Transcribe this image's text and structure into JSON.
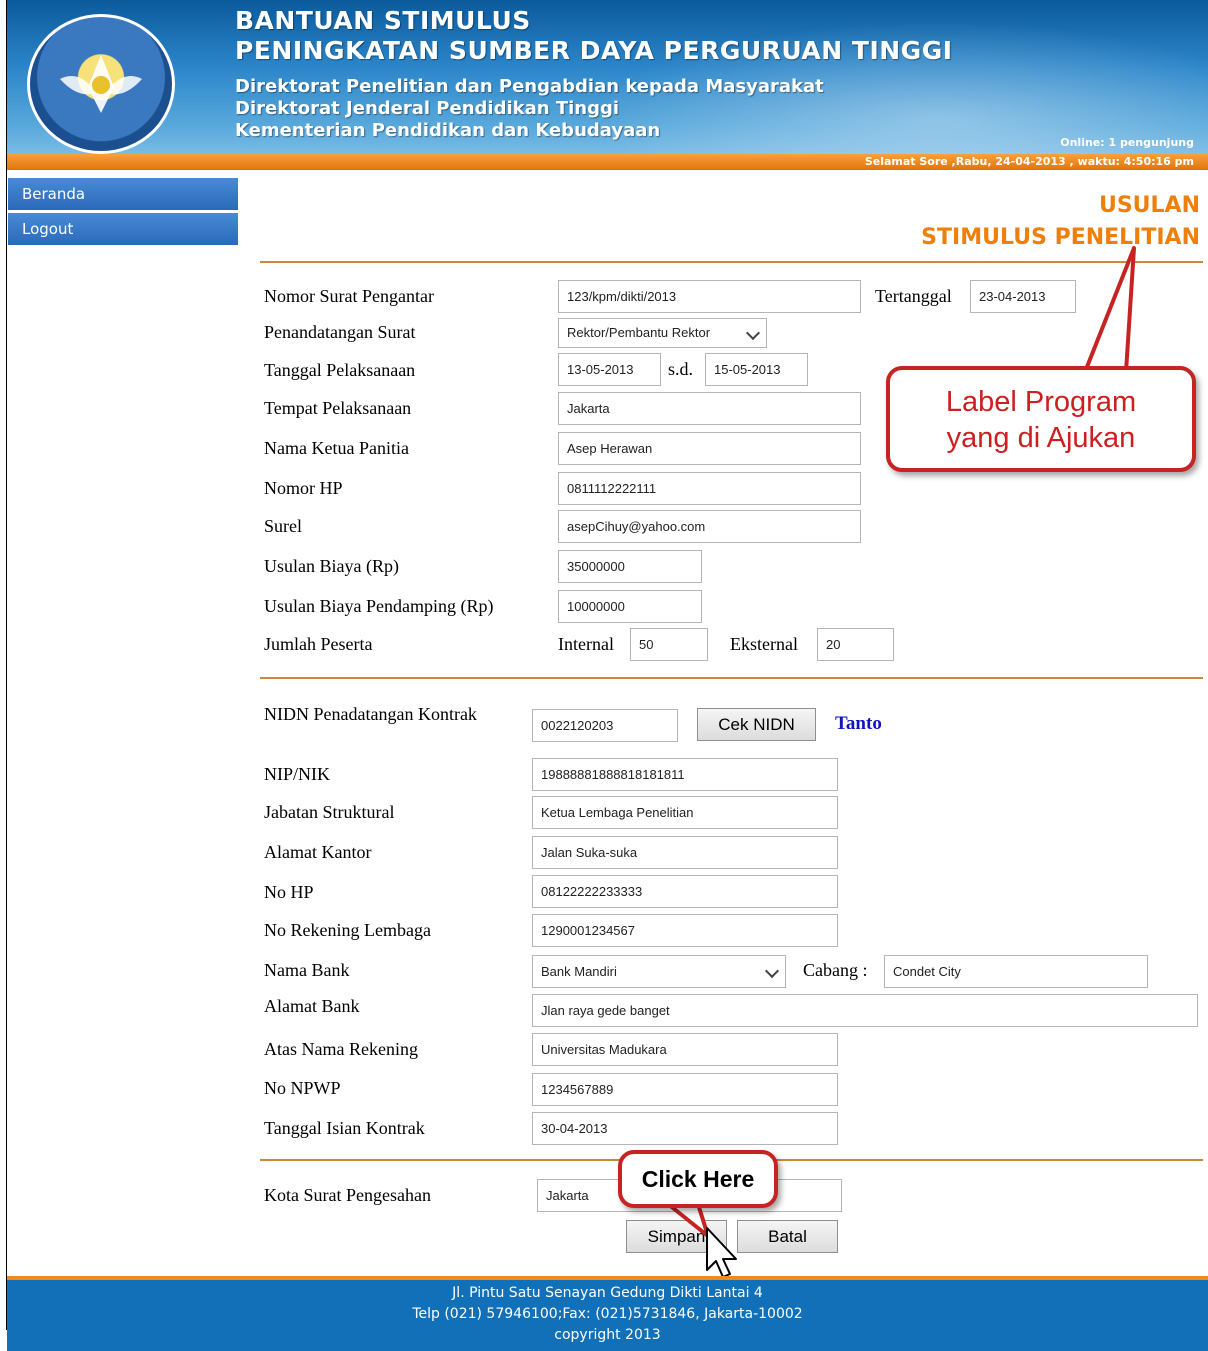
{
  "header": {
    "title_line1": "BANTUAN STIMULUS",
    "title_line2": "PENINGKATAN SUMBER DAYA PERGURUAN TINGGI",
    "line3": "Direktorat Penelitian dan Pengabdian kepada Masyarakat",
    "line4": "Direktorat Jenderal Pendidikan Tinggi",
    "line5": "Kementerian Pendidikan dan Kebudayaan",
    "online": "Online: 1 pengunjung",
    "greeting": "Selamat Sore ,Rabu, 24-04-2013 , waktu: 4:50:16 pm",
    "logo_icon": "tut-wuri-handayani-logo"
  },
  "sidebar": {
    "items": [
      {
        "label": "Beranda"
      },
      {
        "label": "Logout"
      }
    ]
  },
  "page": {
    "title_line1": "USULAN",
    "title_line2": "STIMULUS PENELITIAN"
  },
  "form1": {
    "nomor_surat_label": "Nomor Surat Pengantar",
    "nomor_surat_value": "123/kpm/dikti/2013",
    "tertanggal_label": "Tertanggal",
    "tertanggal_value": "23-04-2013",
    "penandatangan_label": "Penandatangan Surat",
    "penandatangan_value": "Rektor/Pembantu Rektor",
    "tgl_pelaksanaan_label": "Tanggal Pelaksanaan",
    "tgl_mulai_value": "13-05-2013",
    "sd_label": "s.d.",
    "tgl_selesai_value": "15-05-2013",
    "tempat_label": "Tempat Pelaksanaan",
    "tempat_value": "Jakarta",
    "ketua_label": "Nama Ketua Panitia",
    "ketua_value": "Asep Herawan",
    "hp_label": "Nomor HP",
    "hp_value": "0811112222111",
    "surel_label": "Surel",
    "surel_value": "asepCihuy@yahoo.com",
    "biaya_label": "Usulan Biaya (Rp)",
    "biaya_value": "35000000",
    "biaya_pendamping_label": "Usulan Biaya Pendamping (Rp)",
    "biaya_pendamping_value": "10000000",
    "peserta_label": "Jumlah Peserta",
    "internal_label": "Internal",
    "internal_value": "50",
    "eksternal_label": "Eksternal",
    "eksternal_value": "20"
  },
  "form2": {
    "nidn_label": "NIDN Penadatangan Kontrak",
    "nidn_value": "0022120203",
    "cek_nidn_label": "Cek NIDN",
    "nidn_result": "Tanto",
    "nip_label": "NIP/NIK",
    "nip_value": "19888881888818181811",
    "jabatan_label": "Jabatan Struktural",
    "jabatan_value": "Ketua Lembaga Penelitian",
    "alamat_kantor_label": "Alamat Kantor",
    "alamat_kantor_value": "Jalan Suka-suka",
    "nohp_label": "No HP",
    "nohp_value": "08122222233333",
    "rekening_label": "No Rekening Lembaga",
    "rekening_value": "1290001234567",
    "bank_label": "Nama Bank",
    "bank_value": "Bank Mandiri",
    "cabang_label": "Cabang :",
    "cabang_value": "Condet City",
    "alamat_bank_label": "Alamat Bank",
    "alamat_bank_value": "Jlan raya gede banget",
    "atas_nama_label": "Atas Nama Rekening",
    "atas_nama_value": "Universitas Madukara",
    "npwp_label": "No NPWP",
    "npwp_value": "1234567889",
    "tgl_kontrak_label": "Tanggal Isian Kontrak",
    "tgl_kontrak_value": "30-04-2013"
  },
  "form3": {
    "kota_label": "Kota Surat Pengesahan",
    "kota_value": "Jakarta",
    "simpan_label": "Simpan",
    "batal_label": "Batal"
  },
  "annotations": {
    "callout_program_line1": "Label Program",
    "callout_program_line2": "yang di Ajukan",
    "callout_click": "Click Here",
    "callout_color": "#c62323"
  },
  "footer": {
    "line1": "Jl. Pintu Satu Senayan Gedung Dikti Lantai 4",
    "line2": "Telp (021) 57946100;Fax: (021)5731846, Jakarta-10002",
    "line3": "copyright 2013"
  },
  "colors": {
    "header_blue": "#2c86c9",
    "accent_orange": "#ee7f0b",
    "menu_blue": "#2a69b8",
    "footer_blue": "#1270b8"
  }
}
